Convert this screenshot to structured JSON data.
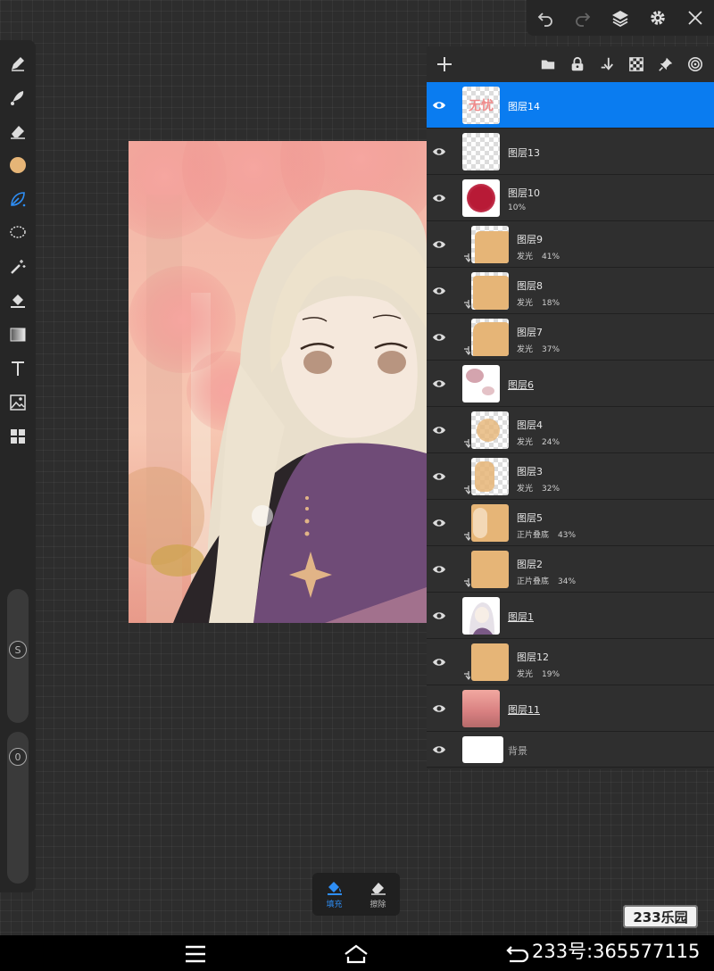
{
  "colors": {
    "accent": "#0a7cf0",
    "fill_active": "#2e8ef5",
    "primary_color": "#e6b577",
    "panel_bg": "#2b2b2b",
    "toolbar_bg": "#262626"
  },
  "top_toolbar": {
    "icons": [
      "undo-icon",
      "redo-icon",
      "layers-icon",
      "gear-icon",
      "close-icon"
    ]
  },
  "left_tools": {
    "icons": [
      "pen-icon",
      "smudge-icon",
      "eraser-icon",
      "color-swatch",
      "brush-icon",
      "lasso-icon",
      "magic-wand-icon",
      "fill-bucket-icon",
      "gradient-icon",
      "text-icon",
      "image-icon",
      "grid-icon"
    ],
    "size_slider_label": "S",
    "opacity_slider_label": "0"
  },
  "layer_panel": {
    "toolbar_icons": [
      "add-icon",
      "folder-icon",
      "lock-icon",
      "merge-down-icon",
      "checker-icon",
      "pin-icon",
      "target-icon"
    ],
    "layers": [
      {
        "name": "图层14",
        "selected": true,
        "thumb_text": "无忧"
      },
      {
        "name": "图层13"
      },
      {
        "name": "图层10",
        "opacity": "10%"
      },
      {
        "name": "图层9",
        "blend": "发光",
        "opacity": "41%",
        "clipped": true
      },
      {
        "name": "图层8",
        "blend": "发光",
        "opacity": "18%",
        "clipped": true
      },
      {
        "name": "图层7",
        "blend": "发光",
        "opacity": "37%",
        "clipped": true
      },
      {
        "name": "图层6"
      },
      {
        "name": "图层4",
        "blend": "发光",
        "opacity": "24%",
        "clipped": true
      },
      {
        "name": "图层3",
        "blend": "发光",
        "opacity": "32%",
        "clipped": true
      },
      {
        "name": "图层5",
        "blend": "正片叠底",
        "opacity": "43%",
        "clipped": true
      },
      {
        "name": "图层2",
        "blend": "正片叠底",
        "opacity": "34%",
        "clipped": true
      },
      {
        "name": "图层1"
      },
      {
        "name": "图层12",
        "blend": "发光",
        "opacity": "19%",
        "clipped": true
      },
      {
        "name": "图层11"
      },
      {
        "name": "背景"
      }
    ]
  },
  "fill_bar": {
    "fill_label": "填充",
    "erase_label": "擦除"
  },
  "watermark": {
    "logo": "233乐园",
    "id_text": "233号:365577115"
  }
}
